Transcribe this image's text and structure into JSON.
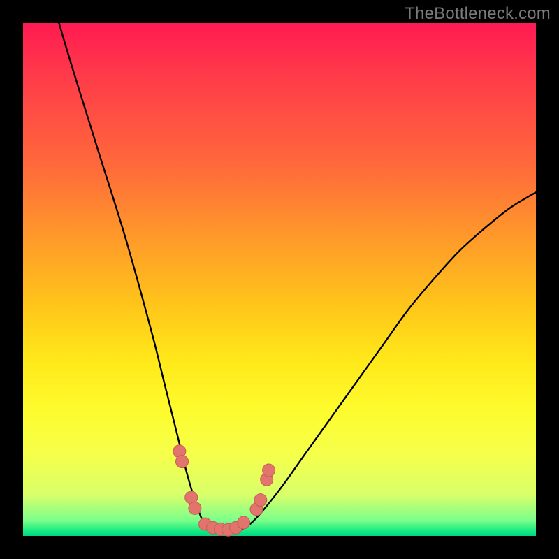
{
  "watermark": {
    "text": "TheBottleneck.com"
  },
  "colors": {
    "background": "#000000",
    "curve_stroke": "#000000",
    "marker_fill": "#e2746e",
    "marker_stroke": "#c95a55"
  },
  "chart_data": {
    "type": "line",
    "title": "",
    "xlabel": "",
    "ylabel": "",
    "xlim": [
      0,
      100
    ],
    "ylim": [
      0,
      100
    ],
    "grid": false,
    "legend": false,
    "series": [
      {
        "name": "bottleneck-curve",
        "x": [
          7,
          10,
          15,
          20,
          25,
          27.5,
          30,
          32,
          33.5,
          35,
          36.5,
          38,
          40,
          42,
          45,
          50,
          55,
          60,
          65,
          70,
          75,
          80,
          85,
          90,
          95,
          100
        ],
        "y": [
          100,
          90,
          74,
          58,
          40,
          30,
          20,
          12,
          7,
          3,
          1,
          0.5,
          0.5,
          1,
          3,
          9,
          16,
          23,
          30,
          37,
          44,
          50,
          55.5,
          60,
          64,
          67
        ]
      }
    ],
    "markers": [
      {
        "x": 30.5,
        "y": 16.5
      },
      {
        "x": 31.0,
        "y": 14.5
      },
      {
        "x": 32.8,
        "y": 7.5
      },
      {
        "x": 33.5,
        "y": 5.4
      },
      {
        "x": 35.5,
        "y": 2.3
      },
      {
        "x": 37.0,
        "y": 1.6
      },
      {
        "x": 38.5,
        "y": 1.3
      },
      {
        "x": 40.0,
        "y": 1.2
      },
      {
        "x": 41.5,
        "y": 1.6
      },
      {
        "x": 43.0,
        "y": 2.6
      },
      {
        "x": 45.5,
        "y": 5.2
      },
      {
        "x": 46.3,
        "y": 7.0
      },
      {
        "x": 47.5,
        "y": 11.0
      },
      {
        "x": 47.9,
        "y": 12.8
      }
    ]
  }
}
